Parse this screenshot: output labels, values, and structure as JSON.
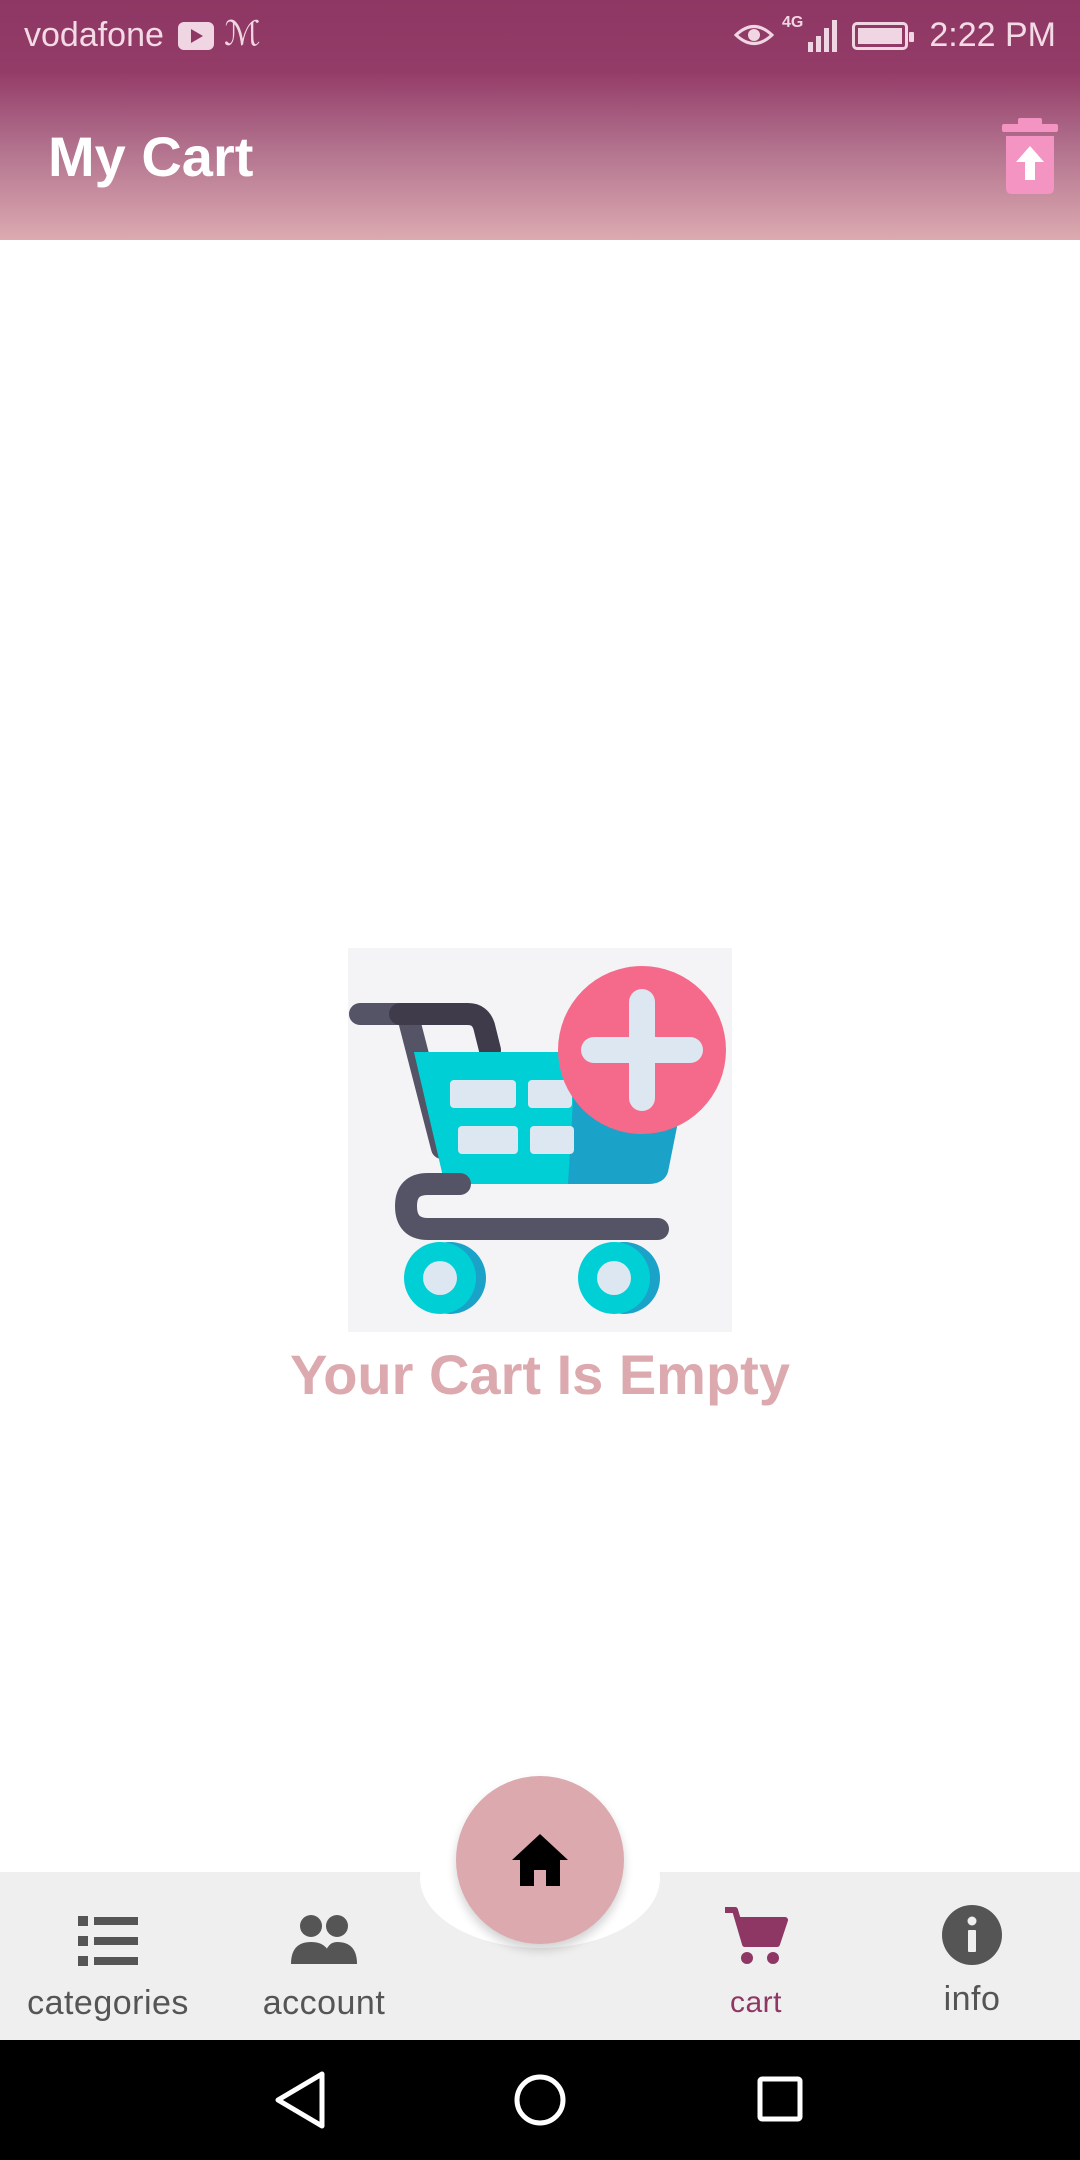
{
  "status_bar": {
    "carrier": "vodafone",
    "network": "4G",
    "time": "2:22 PM"
  },
  "app_bar": {
    "title": "My Cart",
    "clear_icon": "delete-restore-icon"
  },
  "empty_state": {
    "image_icon": "add-to-cart-icon",
    "message": "Your Cart Is Empty"
  },
  "bottom_nav": {
    "fab_icon": "home-icon",
    "items": [
      {
        "label": "categories",
        "icon": "list-icon"
      },
      {
        "label": "account",
        "icon": "people-icon"
      },
      {
        "label": "cart",
        "icon": "cart-icon",
        "active": true
      },
      {
        "label": "info",
        "icon": "info-icon"
      }
    ]
  },
  "colors": {
    "primary": "#8f3764",
    "accent": "#dba9ae",
    "trash": "#f394c2"
  }
}
